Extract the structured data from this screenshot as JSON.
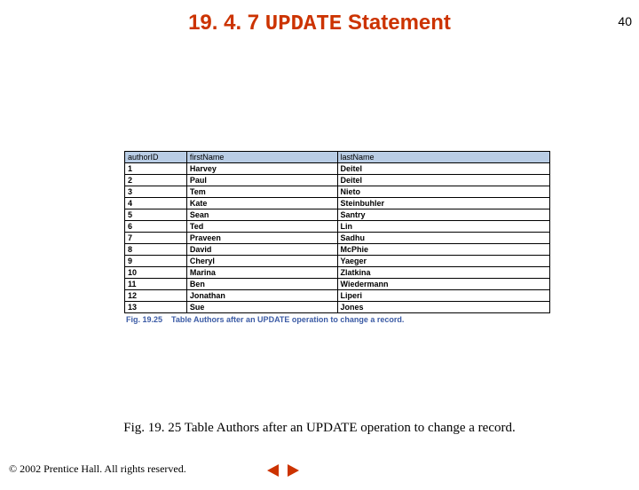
{
  "page_number": "40",
  "title": {
    "section": "19. 4. 7",
    "keyword": "UPDATE",
    "rest": "Statement"
  },
  "table": {
    "headers": [
      "authorID",
      "firstName",
      "lastName"
    ],
    "rows": [
      [
        "1",
        "Harvey",
        "Deitel"
      ],
      [
        "2",
        "Paul",
        "Deitel"
      ],
      [
        "3",
        "Tem",
        "Nieto"
      ],
      [
        "4",
        "Kate",
        "Steinbuhler"
      ],
      [
        "5",
        "Sean",
        "Santry"
      ],
      [
        "6",
        "Ted",
        "Lin"
      ],
      [
        "7",
        "Praveen",
        "Sadhu"
      ],
      [
        "8",
        "David",
        "McPhie"
      ],
      [
        "9",
        "Cheryl",
        "Yaeger"
      ],
      [
        "10",
        "Marina",
        "Zlatkina"
      ],
      [
        "11",
        "Ben",
        "Wiedermann"
      ],
      [
        "12",
        "Jonathan",
        "Liperi"
      ],
      [
        "13",
        "Sue",
        "Jones"
      ]
    ]
  },
  "inner_caption": {
    "lead": "Fig. 19.25",
    "text": "Table Authors after an UPDATE operation to change a record."
  },
  "caption": "Fig. 19. 25 Table Authors after an UPDATE operation to change a record.",
  "footer": "© 2002 Prentice Hall.  All rights reserved.",
  "nav": {
    "prev": "prev",
    "next": "next"
  }
}
